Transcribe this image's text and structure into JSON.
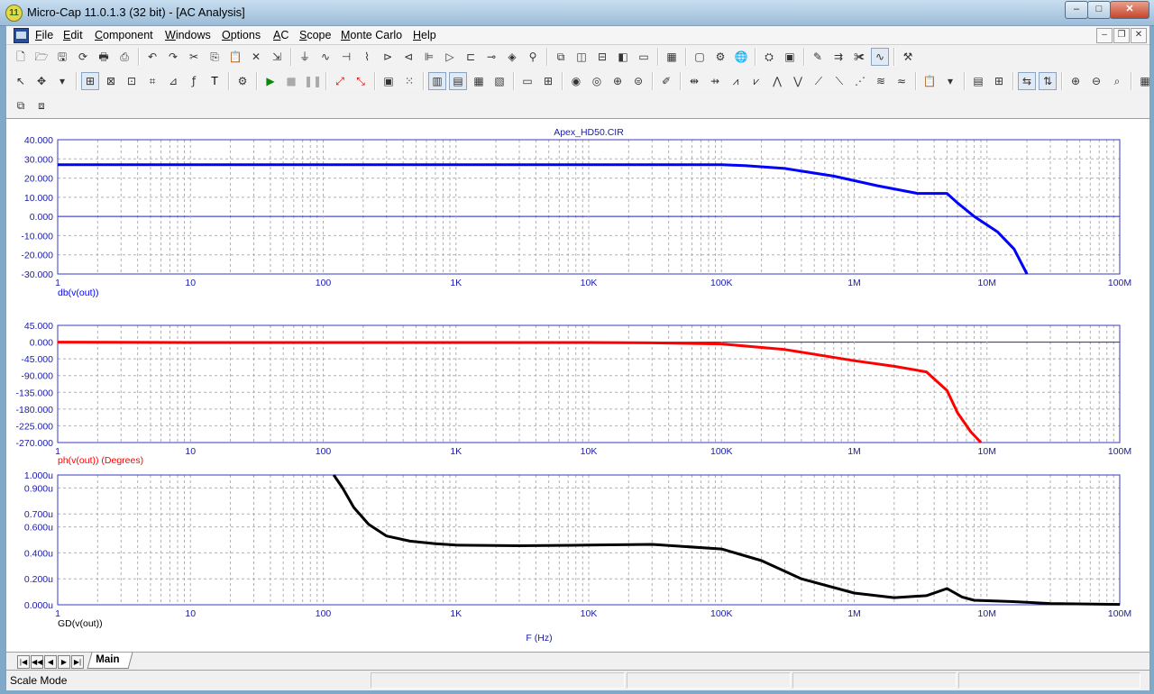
{
  "window": {
    "app_icon": "microcap-app-icon",
    "app_icon_glyph": "11",
    "title": "Micro-Cap 11.0.1.3 (32 bit) - [AC Analysis]",
    "min_glyph": "–",
    "max_glyph": "□",
    "close_glyph": "✕"
  },
  "menu": {
    "items": [
      "File",
      "Edit",
      "Component",
      "Windows",
      "Options",
      "AC",
      "Scope",
      "Monte Carlo",
      "Help"
    ],
    "mdi_min": "–",
    "mdi_restore": "❐",
    "mdi_close": "✕"
  },
  "tabs": {
    "main": "Main"
  },
  "status": {
    "mode": "Scale Mode"
  },
  "chart_data": [
    {
      "type": "line",
      "title": "Apex_HD50.CIR",
      "xscale": "log",
      "xlim": [
        1,
        100000000
      ],
      "xticks": [
        "1",
        "10",
        "100",
        "1K",
        "10K",
        "100K",
        "1M",
        "10M",
        "100M"
      ],
      "ylim": [
        -30,
        40
      ],
      "yticks": [
        "40.000",
        "30.000",
        "20.000",
        "10.000",
        "0.000",
        "-10.000",
        "-20.000",
        "-30.000"
      ],
      "ylabel": "db(v(out))",
      "color": "#0000ff",
      "grid": true,
      "series": [
        {
          "name": "db(v(out))",
          "x": [
            1,
            10,
            100,
            1000,
            10000,
            100000,
            150000,
            300000,
            700000,
            1500000,
            3000000,
            5000000,
            6000000,
            8000000,
            12000000,
            16000000,
            20000000
          ],
          "y": [
            27,
            27,
            27,
            27,
            27,
            27,
            26.5,
            25,
            21,
            16,
            12,
            12,
            7,
            0,
            -8,
            -17,
            -30
          ]
        }
      ]
    },
    {
      "type": "line",
      "xscale": "log",
      "xlim": [
        1,
        100000000
      ],
      "xticks": [
        "1",
        "10",
        "100",
        "1K",
        "10K",
        "100K",
        "1M",
        "10M",
        "100M"
      ],
      "ylim": [
        -270,
        45
      ],
      "yticks": [
        "45.000",
        "0.000",
        "-45.000",
        "-90.000",
        "-135.000",
        "-180.000",
        "-225.000",
        "-270.000"
      ],
      "ylabel": "ph(v(out)) (Degrees)",
      "color": "#ff0000",
      "grid": true,
      "series": [
        {
          "name": "ph(v(out)) (Degrees)",
          "x": [
            1,
            10,
            100,
            1000,
            10000,
            30000,
            100000,
            300000,
            1000000,
            2000000,
            3500000,
            5000000,
            6000000,
            7500000,
            9000000
          ],
          "y": [
            0,
            -1,
            -1,
            -1,
            -1,
            -2,
            -5,
            -20,
            -50,
            -65,
            -80,
            -130,
            -190,
            -240,
            -270
          ]
        }
      ]
    },
    {
      "type": "line",
      "xscale": "log",
      "xlim": [
        1,
        100000000
      ],
      "xticks": [
        "1",
        "10",
        "100",
        "1K",
        "10K",
        "100K",
        "1M",
        "10M",
        "100M"
      ],
      "ylim": [
        0,
        1
      ],
      "yticks": [
        {
          "v": 1,
          "t": "1.000u"
        },
        {
          "v": 0.9,
          "t": "0.900u"
        },
        {
          "v": 0.7,
          "t": "0.700u"
        },
        {
          "v": 0.6,
          "t": "0.600u"
        },
        {
          "v": 0.4,
          "t": "0.400u"
        },
        {
          "v": 0.2,
          "t": "0.200u"
        },
        {
          "v": 0,
          "t": "0.000u"
        }
      ],
      "ylabel": "GD(v(out))",
      "xlabel": "F (Hz)",
      "color": "#000000",
      "grid": true,
      "series": [
        {
          "name": "GD(v(out))",
          "x": [
            120,
            140,
            170,
            220,
            300,
            450,
            700,
            1000,
            3000,
            10000,
            30000,
            100000,
            200000,
            400000,
            1000000,
            2000000,
            3500000,
            5000000,
            6500000,
            8000000,
            15000000,
            30000000,
            100000000
          ],
          "y": [
            1.0,
            0.9,
            0.75,
            0.62,
            0.53,
            0.49,
            0.47,
            0.46,
            0.455,
            0.46,
            0.465,
            0.43,
            0.34,
            0.2,
            0.09,
            0.055,
            0.07,
            0.125,
            0.06,
            0.035,
            0.025,
            0.01,
            0.003
          ]
        }
      ]
    }
  ]
}
